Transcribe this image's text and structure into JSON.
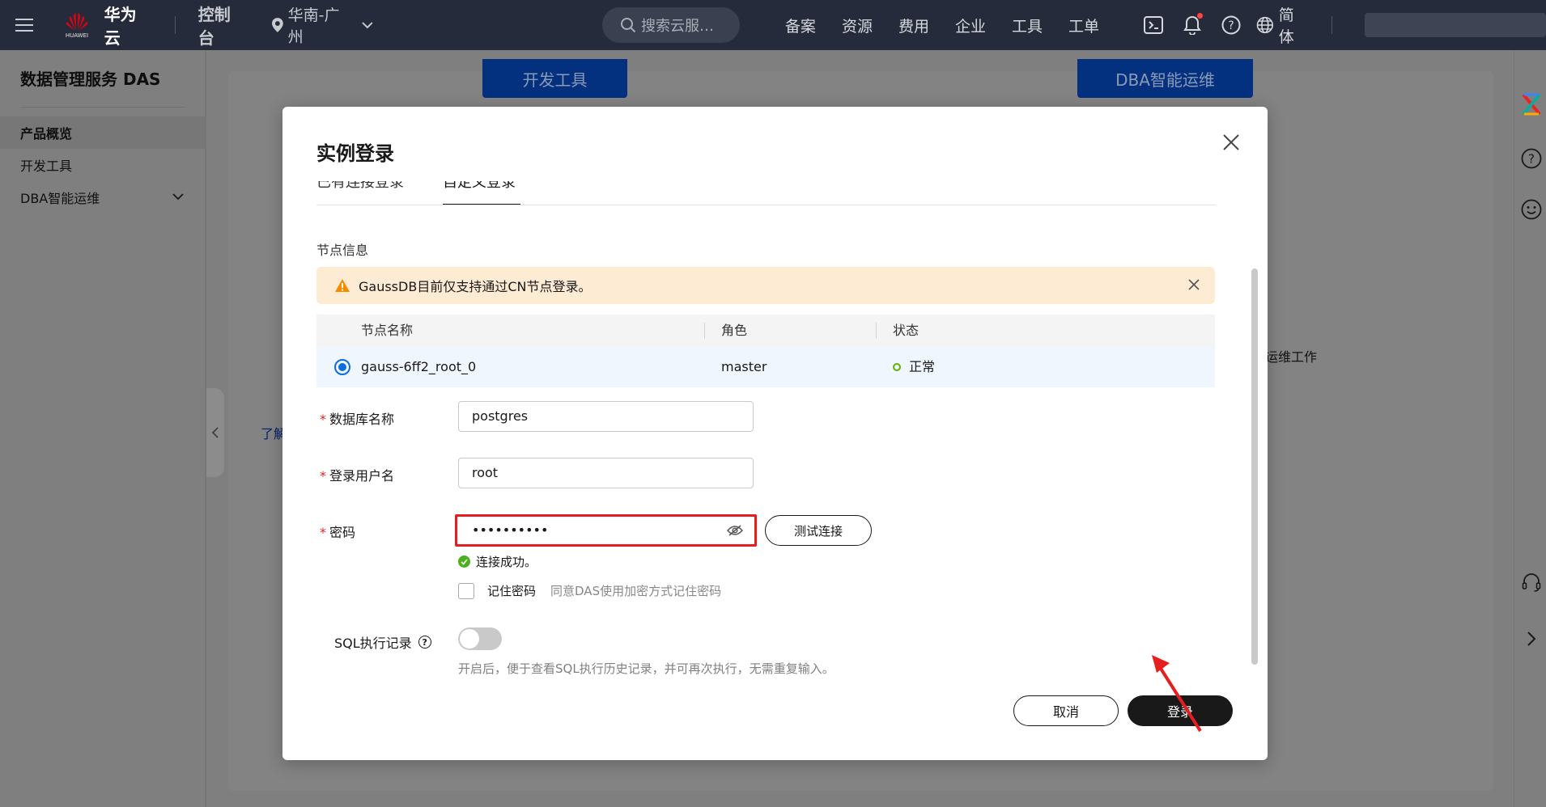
{
  "topbar": {
    "brand": "华为云",
    "brand_sub": "HUAWEI",
    "console": "控制台",
    "region": "华南-广州",
    "search_placeholder": "搜索云服…",
    "links": [
      "备案",
      "资源",
      "费用",
      "企业",
      "工具",
      "工单"
    ],
    "lang": "简体",
    "colors": {
      "bg": "#252b3a",
      "logo": "#e60012"
    }
  },
  "sidebar": {
    "title": "数据管理服务 DAS",
    "items": [
      {
        "label": "产品概览",
        "active": true
      },
      {
        "label": "开发工具",
        "active": false
      },
      {
        "label": "DBA智能运维",
        "active": false,
        "expandable": true
      }
    ]
  },
  "background": {
    "tab_dev": "开发工具",
    "tab_dba": "DBA智能运维",
    "side_text": "运维工作",
    "link_text": "了解"
  },
  "modal": {
    "title": "实例登录",
    "tabs": [
      {
        "label": "已有连接登录",
        "active": false
      },
      {
        "label": "自定义登录",
        "active": true
      }
    ],
    "node_info_label": "节点信息",
    "alert": "GaussDB目前仅支持通过CN节点登录。",
    "table": {
      "headers": [
        "节点名称",
        "角色",
        "状态"
      ],
      "rows": [
        {
          "name": "gauss-6ff2_root_0",
          "role": "master",
          "status": "正常",
          "selected": true
        }
      ]
    },
    "fields": {
      "db_name": {
        "label": "数据库名称",
        "value": "postgres"
      },
      "username": {
        "label": "登录用户名",
        "value": "root"
      },
      "password": {
        "label": "密码",
        "value": "••••••••••"
      }
    },
    "test_button": "测试连接",
    "success_msg": "连接成功。",
    "remember": {
      "label": "记住密码",
      "hint": "同意DAS使用加密方式记住密码",
      "checked": false
    },
    "sql_record": {
      "label": "SQL执行记录",
      "hint": "开启后，便于查看SQL执行历史记录，并可再次执行，无需重复输入。",
      "enabled": false
    },
    "cancel": "取消",
    "login": "登录",
    "colors": {
      "accent": "#0b6ee0",
      "error": "#e51f1f",
      "success": "#4caf1f",
      "alert_bg": "#fdebd3"
    }
  }
}
